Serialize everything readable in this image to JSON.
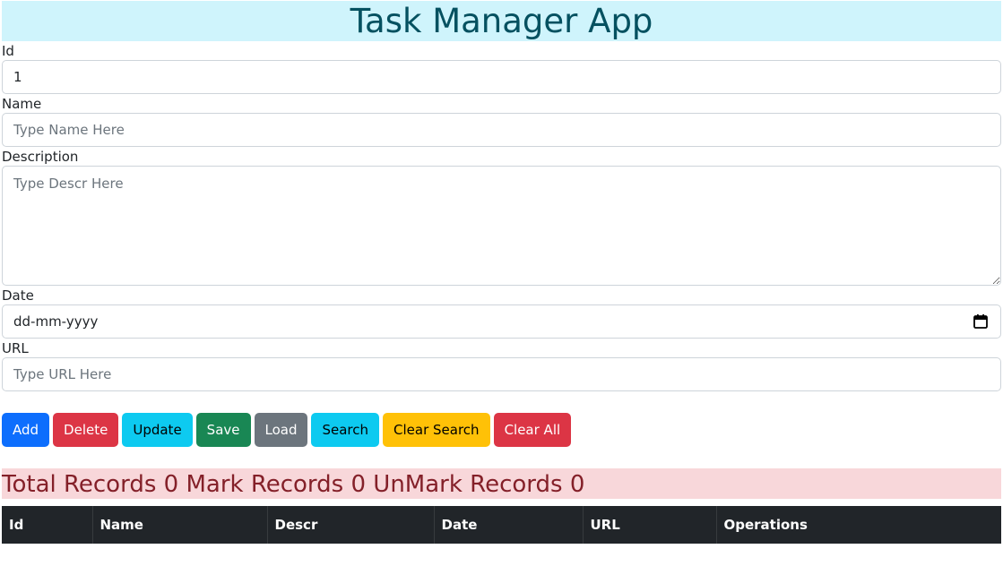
{
  "header": {
    "title": "Task Manager App"
  },
  "form": {
    "id": {
      "label": "Id",
      "value": "1"
    },
    "name": {
      "label": "Name",
      "placeholder": "Type Name Here"
    },
    "description": {
      "label": "Description",
      "placeholder": "Type Descr Here"
    },
    "date": {
      "label": "Date",
      "value": "dd-mm-yyyy"
    },
    "url": {
      "label": "URL",
      "placeholder": "Type URL Here"
    }
  },
  "buttons": {
    "add": "Add",
    "delete": "Delete",
    "update": "Update",
    "save": "Save",
    "load": "Load",
    "search": "Search",
    "clear_search": "Clear Search",
    "clear_all": "Clear All"
  },
  "records": {
    "total_label": "Total Records",
    "total": "0",
    "mark_label": "Mark Records",
    "mark": "0",
    "unmark_label": "UnMark Records",
    "unmark": "0"
  },
  "table": {
    "columns": [
      "Id",
      "Name",
      "Descr",
      "Date",
      "URL",
      "Operations"
    ]
  },
  "icons": {
    "date_picker": "calendar-icon"
  },
  "colors": {
    "header_bg": "#cff4fc",
    "header_text": "#055160",
    "records_bg": "#f8d7da",
    "records_text": "#842029",
    "table_bg": "#212529"
  }
}
